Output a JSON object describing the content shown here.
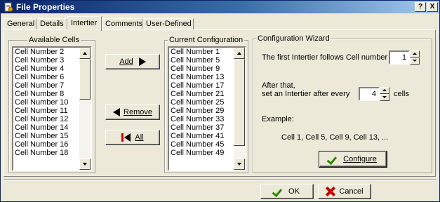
{
  "window": {
    "title": "File Properties",
    "help_label": "?",
    "close_label": "X"
  },
  "tabs": [
    {
      "label": "General"
    },
    {
      "label": "Details"
    },
    {
      "label": "Intertier"
    },
    {
      "label": "Comments"
    },
    {
      "label": "User-Defined"
    }
  ],
  "available": {
    "title": "Available Cells",
    "items": [
      "Cell Number  2",
      "Cell Number  3",
      "Cell Number  4",
      "Cell Number  6",
      "Cell Number  7",
      "Cell Number  8",
      "Cell Number  10",
      "Cell Number  11",
      "Cell Number  12",
      "Cell Number  14",
      "Cell Number  15",
      "Cell Number  16",
      "Cell Number  18"
    ]
  },
  "current": {
    "title": "Current Configuration",
    "items": [
      "Cell Number  1",
      "Cell Number  5",
      "Cell Number  9",
      "Cell Number  13",
      "Cell Number  17",
      "Cell Number  21",
      "Cell Number  25",
      "Cell Number  29",
      "Cell Number  33",
      "Cell Number  37",
      "Cell Number  41",
      "Cell Number  45",
      "Cell Number  49"
    ]
  },
  "buttons": {
    "add": "Add",
    "remove": "Remove",
    "all": "All"
  },
  "wizard": {
    "title": "Configuration Wizard",
    "first_label": "The first Intertier follows Cell number",
    "first_value": "1",
    "after_line1": "After that,",
    "after_line2": "set an Intertier after every",
    "every_value": "4",
    "cells_label": "cells",
    "example_label": "Example:",
    "example_text": "Cell 1,  Cell 5,  Cell 9,  Cell 13,  ...",
    "configure": "Configure"
  },
  "footer": {
    "ok": "OK",
    "cancel": "Cancel"
  },
  "colors": {
    "title_start": "#0a246a",
    "title_end": "#a6caf0",
    "check": "#2e8b00",
    "x": "#c80000"
  }
}
